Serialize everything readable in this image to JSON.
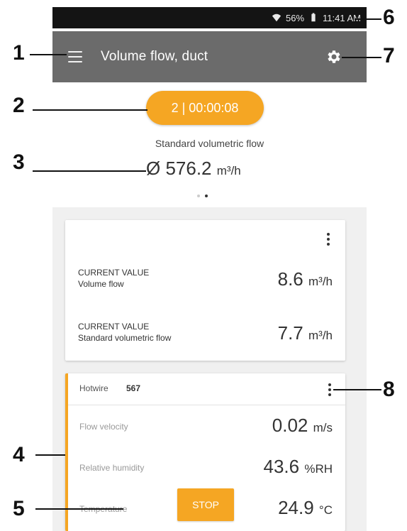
{
  "status_bar": {
    "battery": "56%",
    "time": "11:41 AM"
  },
  "app_bar": {
    "title": "Volume flow, duct",
    "menu_icon": "hamburger-menu-icon",
    "settings_icon": "gear-icon"
  },
  "timer_pill": {
    "label": "2 | 00:00:08"
  },
  "summary": {
    "label": "Standard volumetric flow",
    "value": "Ø 576.2",
    "unit": "m³/h"
  },
  "page_indicator": {
    "pages": 2,
    "active": 2
  },
  "card_current": {
    "rows": [
      {
        "line1": "CURRENT VALUE",
        "line2": "Volume flow",
        "value": "8.6",
        "unit": "m³/h"
      },
      {
        "line1": "CURRENT VALUE",
        "line2": "Standard volumetric flow",
        "value": "7.7",
        "unit": "m³/h"
      }
    ]
  },
  "card_probe": {
    "sensor_name": "Hotwire",
    "sensor_id": "567",
    "rows": [
      {
        "label": "Flow velocity",
        "value": "0.02",
        "unit": "m/s"
      },
      {
        "label": "Relative humidity",
        "value": "43.6",
        "unit": "%RH"
      },
      {
        "label": "Temperature",
        "value": "24.9",
        "unit": "°C"
      }
    ]
  },
  "stop_button": {
    "label": "STOP"
  },
  "callouts": [
    "1",
    "2",
    "3",
    "4",
    "5",
    "6",
    "7",
    "8"
  ],
  "colors": {
    "accent": "#f5a623",
    "app_bar": "#6b6b6b",
    "status_bar": "#141414"
  }
}
